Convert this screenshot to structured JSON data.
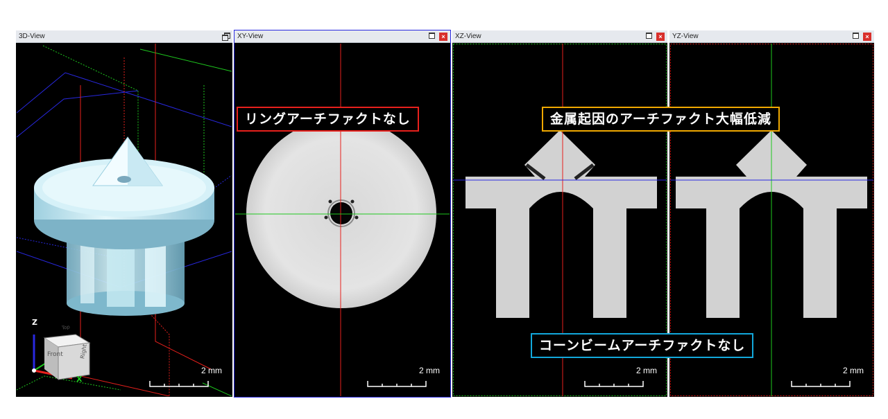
{
  "panels": {
    "view3d": {
      "title": "3D-View",
      "scale_label": "2 mm"
    },
    "xy": {
      "title": "XY-View",
      "scale_label": "2 mm"
    },
    "xz": {
      "title": "XZ-View",
      "scale_label": "2 mm"
    },
    "yz": {
      "title": "YZ-View",
      "scale_label": "2 mm"
    }
  },
  "nav_cube": {
    "top": "Top",
    "front": "Front",
    "right": "Right",
    "axis_z": "Z",
    "axis_x": "X"
  },
  "callouts": {
    "no_ring": "リングアーチファクトなし",
    "metal_reduced": "金属起因のアーチファクト大幅低減",
    "no_conebeam": "コーンビームアーチファクトなし"
  },
  "colors": {
    "red": "#e8201c",
    "orange": "#f0a800",
    "cyan": "#12a8dc",
    "green": "#1ec81e",
    "blue": "#2828e0"
  }
}
